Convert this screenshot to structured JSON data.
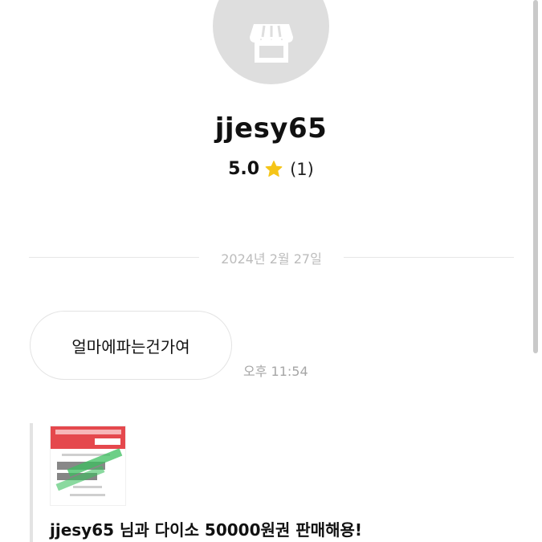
{
  "profile": {
    "avatar_icon": "store-icon",
    "name": "jjesy65",
    "rating_value": "5.0",
    "rating_icon": "star-icon",
    "rating_count": "(1)"
  },
  "chat": {
    "date_divider": "2024년 2월 27일",
    "messages": [
      {
        "text": "얼마에파는건가여",
        "time": "오후 11:54"
      }
    ],
    "product_card": {
      "thumbnail_icon": "voucher-thumbnail",
      "title": "jjesy65 님과 다이소 50000원권 판매해용!"
    }
  },
  "colors": {
    "avatar_bg": "#dedede",
    "star": "#f5c518",
    "muted_text": "#a6a6a6"
  }
}
